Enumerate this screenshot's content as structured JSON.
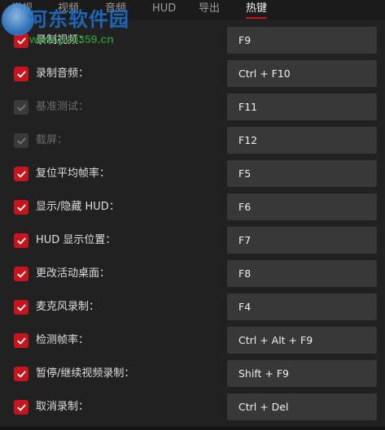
{
  "tabs": [
    {
      "label": "常规"
    },
    {
      "label": "视频"
    },
    {
      "label": "音频"
    },
    {
      "label": "HUD"
    },
    {
      "label": "导出"
    },
    {
      "label": "热键"
    }
  ],
  "watermark": {
    "title": "河东软件园",
    "url": "www.pc0359.cn"
  },
  "hotkeys": [
    {
      "label": "录制视频：",
      "key": "F9",
      "checked": true,
      "enabled": true
    },
    {
      "label": "录制音频：",
      "key": "Ctrl + F10",
      "checked": true,
      "enabled": true
    },
    {
      "label": "基准测试：",
      "key": "F11",
      "checked": true,
      "enabled": false
    },
    {
      "label": "截屏：",
      "key": "F12",
      "checked": true,
      "enabled": false
    },
    {
      "label": "复位平均帧率：",
      "key": "F5",
      "checked": true,
      "enabled": true
    },
    {
      "label": "显示/隐藏 HUD：",
      "key": "F6",
      "checked": true,
      "enabled": true
    },
    {
      "label": "HUD 显示位置：",
      "key": "F7",
      "checked": true,
      "enabled": true
    },
    {
      "label": "更改活动桌面：",
      "key": "F8",
      "checked": true,
      "enabled": true
    },
    {
      "label": "麦克风录制：",
      "key": "F4",
      "checked": true,
      "enabled": true
    },
    {
      "label": "检测帧率：",
      "key": "Ctrl + Alt + F9",
      "checked": true,
      "enabled": true
    },
    {
      "label": "暂停/继续视频录制：",
      "key": "Shift + F9",
      "checked": true,
      "enabled": true
    },
    {
      "label": "取消录制：",
      "key": "Ctrl + Del",
      "checked": true,
      "enabled": true
    }
  ]
}
